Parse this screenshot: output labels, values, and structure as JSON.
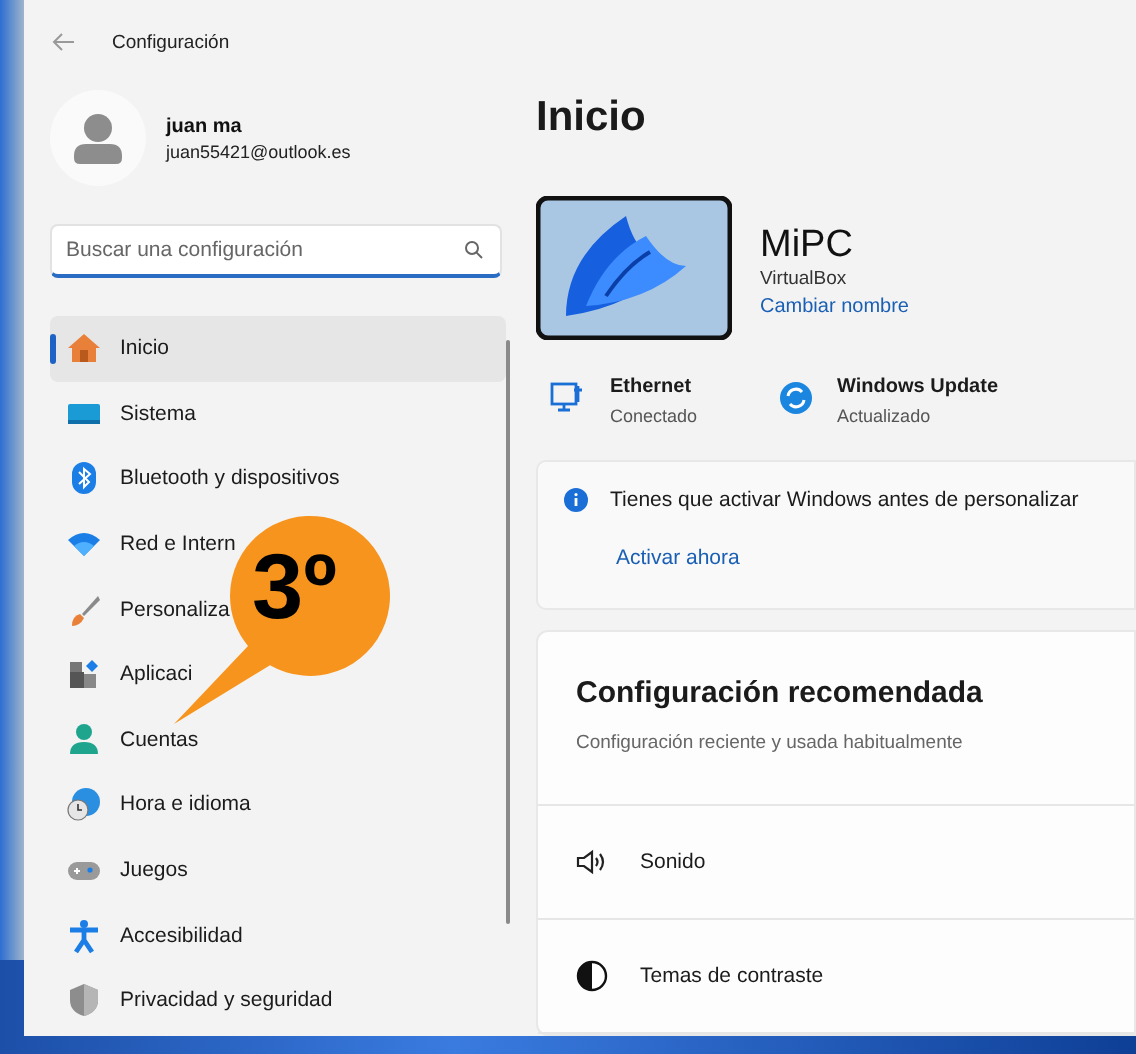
{
  "window": {
    "title": "Configuración"
  },
  "account": {
    "name": "juan ma",
    "email": "juan55421@outlook.es"
  },
  "search": {
    "placeholder": "Buscar una configuración"
  },
  "sidebar": {
    "items": [
      {
        "label": "Inicio",
        "selected": true
      },
      {
        "label": "Sistema",
        "selected": false
      },
      {
        "label": "Bluetooth y dispositivos",
        "selected": false
      },
      {
        "label": "Red e Intern",
        "selected": false
      },
      {
        "label": "Personaliza",
        "selected": false
      },
      {
        "label": "Aplicaci",
        "selected": false
      },
      {
        "label": "Cuentas",
        "selected": false
      },
      {
        "label": "Hora e idioma",
        "selected": false
      },
      {
        "label": "Juegos",
        "selected": false
      },
      {
        "label": "Accesibilidad",
        "selected": false
      },
      {
        "label": "Privacidad y seguridad",
        "selected": false
      }
    ]
  },
  "page": {
    "title": "Inicio",
    "device": {
      "name": "MiPC",
      "model": "VirtualBox",
      "rename": "Cambiar nombre"
    },
    "status": [
      {
        "title": "Ethernet",
        "detail": "Conectado"
      },
      {
        "title": "Windows Update",
        "detail": "Actualizado"
      }
    ],
    "notice": {
      "text": "Tienes que activar Windows antes de personalizar",
      "link": "Activar ahora"
    },
    "recommended": {
      "title": "Configuración recomendada",
      "subtitle": "Configuración reciente y usada habitualmente",
      "items": [
        {
          "label": "Sonido"
        },
        {
          "label": "Temas de contraste"
        }
      ]
    }
  },
  "callout": {
    "label": "3º"
  }
}
